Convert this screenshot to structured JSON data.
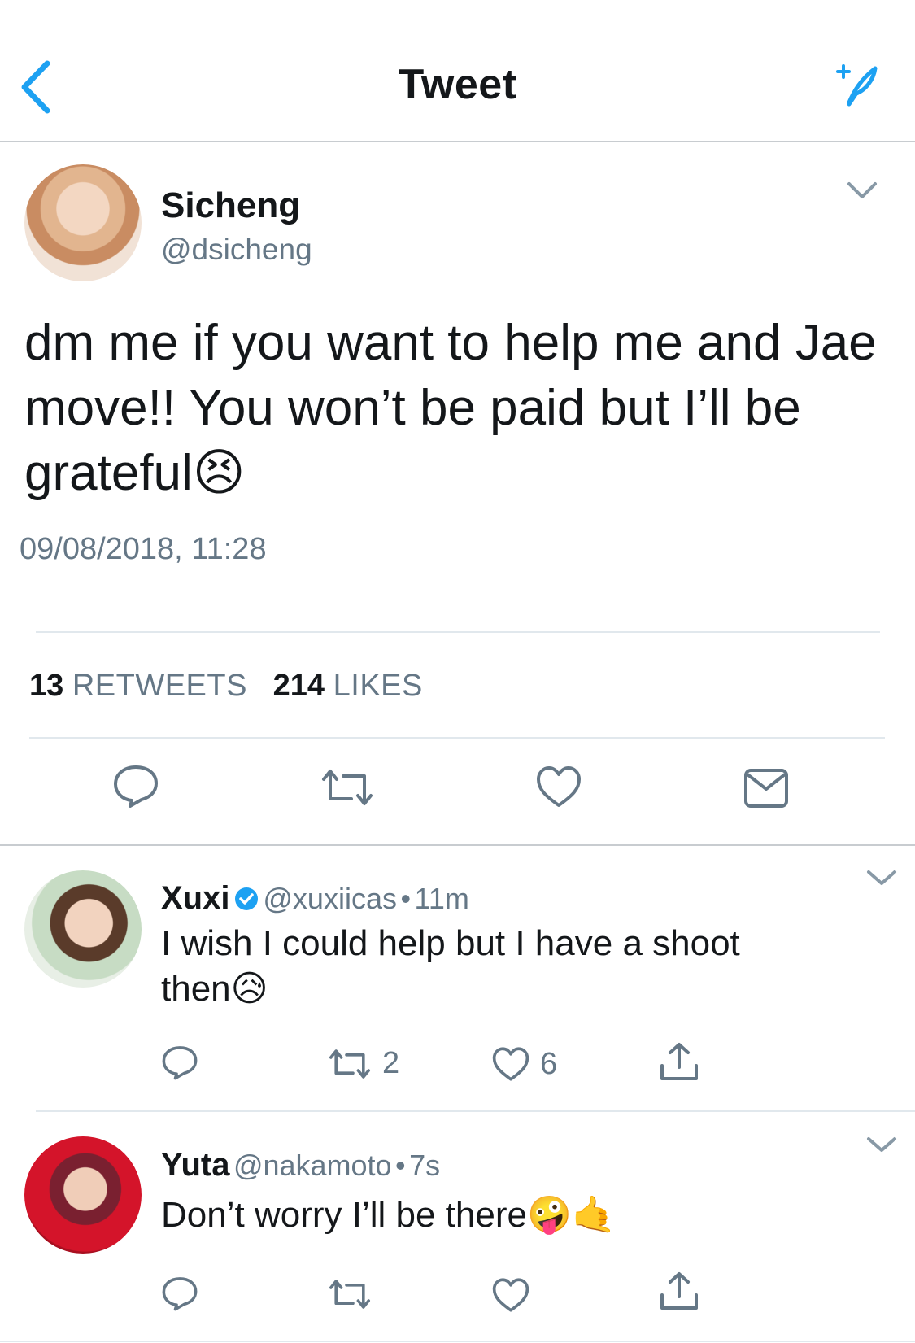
{
  "header": {
    "title": "Tweet",
    "back_icon": "chevron-left-icon",
    "compose_icon": "compose-feather-icon",
    "accent": "#1da1f2"
  },
  "main_tweet": {
    "name": "Sicheng",
    "handle": "@dsicheng",
    "text": "dm me if you want to help me and Jae move!! You won’t be paid but I’ll be grateful",
    "emoji": "😣",
    "timestamp": "09/08/2018, 11:28",
    "retweets_count": "13",
    "retweets_label": "RETWEETS",
    "likes_count": "214",
    "likes_label": "LIKES"
  },
  "replies": [
    {
      "name": "Xuxi",
      "verified": true,
      "handle": "@xuxiicas",
      "time": "11m",
      "separator": "•",
      "text_line1": "I wish I could help but I have a shoot",
      "text_line2": "then",
      "emoji": "😥",
      "retweets": "2",
      "likes": "6"
    },
    {
      "name": "Yuta",
      "handle": "@nakamoto",
      "time": "7s",
      "separator": "•",
      "text": "Don’t worry I’ll be there",
      "emoji": "🤪🤙"
    }
  ],
  "colors": {
    "text": "#14171a",
    "secondary": "#657786",
    "divider": "#e1e8ed",
    "verified": "#1da1f2"
  }
}
